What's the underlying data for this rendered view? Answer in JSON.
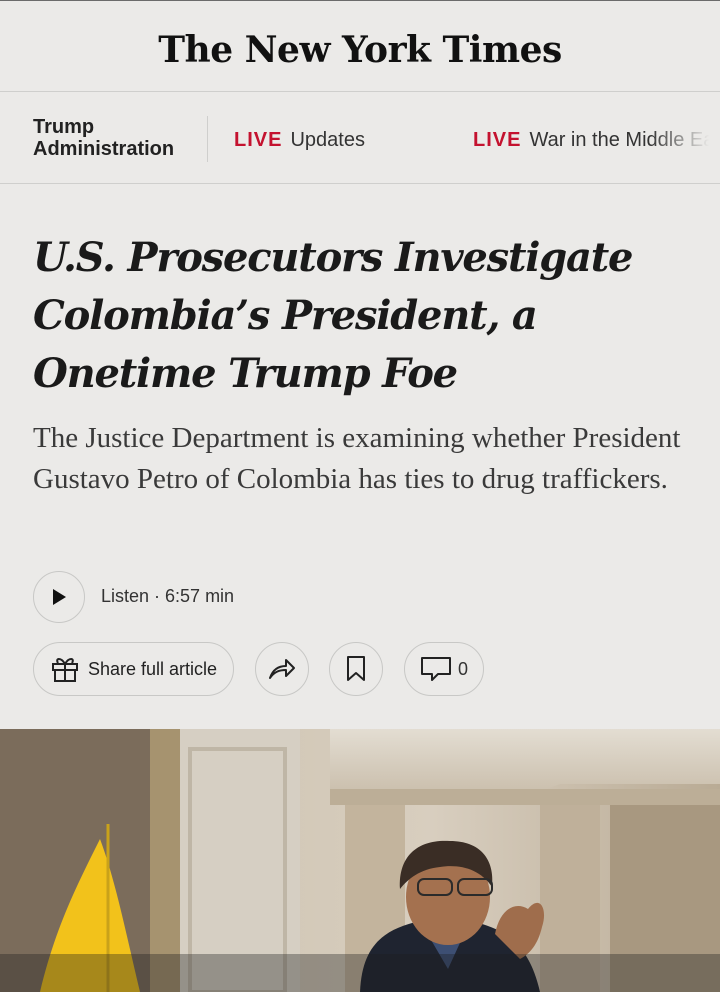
{
  "masthead": {
    "logo": "The New York Times"
  },
  "topic_bar": {
    "section": [
      "Trump",
      "Administration"
    ],
    "items": [
      {
        "badge": "LIVE",
        "label": "Updates"
      },
      {
        "badge": "LIVE",
        "label": "War in the Middle East"
      }
    ]
  },
  "article": {
    "headline": "U.S. Prosecutors Investigate Colombia’s President, a Onetime Trump Foe",
    "summary": "The Justice Department is examining whether President Gustavo Petro of Colombia has ties to drug traffickers."
  },
  "audio": {
    "label": "Listen · 6:57 min",
    "icon": "play-icon"
  },
  "actions": {
    "share_full_label": "Share full article",
    "share_icon": "gift-icon",
    "share_arrow_icon": "share-arrow-icon",
    "save_icon": "bookmark-icon",
    "comments_icon": "comment-icon",
    "comments_count": "0"
  },
  "colors": {
    "live": "#c4122f",
    "background": "#ebeae8",
    "flag_yellow": "#f2c21b"
  }
}
